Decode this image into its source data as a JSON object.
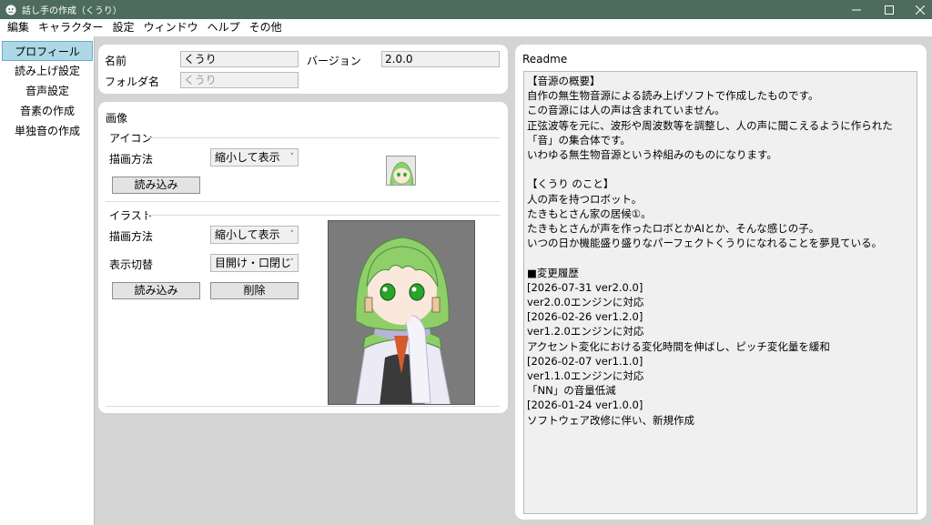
{
  "window": {
    "title": "話し手の作成（くうり）"
  },
  "menu": [
    "編集",
    "キャラクター",
    "設定",
    "ウィンドウ",
    "ヘルプ",
    "その他"
  ],
  "sidebar": [
    "プロフィール",
    "読み上げ設定",
    "音声設定",
    "音素の作成",
    "単独音の作成"
  ],
  "profile": {
    "name_label": "名前",
    "name_value": "くうり",
    "version_label": "バージョン",
    "version_value": "2.0.0",
    "folder_label": "フォルダ名",
    "folder_value": "くうり"
  },
  "image": {
    "section_title": "画像",
    "icon": {
      "title": "アイコン",
      "render_label": "描画方法",
      "render_value": "縮小して表示",
      "load_button": "読み込み"
    },
    "illust": {
      "title": "イラスト",
      "render_label": "描画方法",
      "render_value": "縮小して表示",
      "switch_label": "表示切替",
      "switch_value": "目開け・口閉じ",
      "load_button": "読み込み",
      "delete_button": "削除"
    }
  },
  "readme": {
    "title": "Readme",
    "text": "【音源の概要】\n自作の無生物音源による読み上げソフトで作成したものです。\nこの音源には人の声は含まれていません。\n正弦波等を元に、波形や周波数等を調整し、人の声に聞こえるように作られた「音」の集合体です。\nいわゆる無生物音源という枠組みのものになります。\n\n【くうり のこと】\n人の声を持つロボット。\nたきもとさん家の居候①。\nたきもとさんが声を作ったロボとかAIとか、そんな感じの子。\nいつの日か機能盛り盛りなパーフェクトくうりになれることを夢見ている。\n\n■変更履歴\n[2026-07-31 ver2.0.0]\nver2.0.0エンジンに対応\n[2026-02-26 ver1.2.0]\nver1.2.0エンジンに対応\nアクセント変化における変化時間を伸ばし、ピッチ変化量を緩和\n[2026-02-07 ver1.1.0]\nver1.1.0エンジンに対応\n「NN」の音量低減\n[2026-01-24 ver1.0.0]\nソフトウェア改修に伴い、新規作成"
  },
  "colors": {
    "titlebar": "#4d6b5e",
    "selected_nav": "#add8e6",
    "hair": "#8fcf6a",
    "eyes": "#2aa52a"
  }
}
